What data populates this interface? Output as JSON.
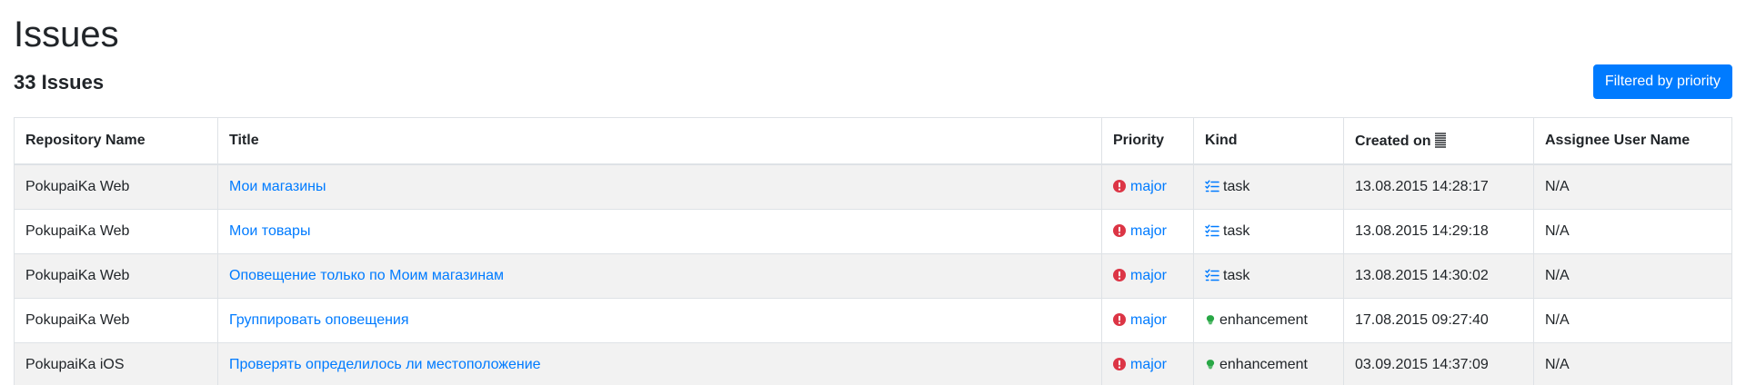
{
  "page": {
    "title": "Issues",
    "count_label": "33 Issues",
    "filter_button": "Filtered by priority"
  },
  "table": {
    "headers": {
      "repo": "Repository Name",
      "title": "Title",
      "priority": "Priority",
      "kind": "Kind",
      "created": "Created on",
      "assignee": "Assignee User Name"
    },
    "sort_icon": "sort-lines-icon",
    "rows": [
      {
        "repo": "PokupaiKa Web",
        "title": "Мои магазины",
        "priority": "major",
        "priority_icon": "exclamation-circle-icon",
        "kind": "task",
        "kind_icon": "task-list-icon",
        "created": "13.08.2015 14:28:17",
        "assignee": "N/A"
      },
      {
        "repo": "PokupaiKa Web",
        "title": "Мои товары",
        "priority": "major",
        "priority_icon": "exclamation-circle-icon",
        "kind": "task",
        "kind_icon": "task-list-icon",
        "created": "13.08.2015 14:29:18",
        "assignee": "N/A"
      },
      {
        "repo": "PokupaiKa Web",
        "title": "Оповещение только по Моим магазинам",
        "priority": "major",
        "priority_icon": "exclamation-circle-icon",
        "kind": "task",
        "kind_icon": "task-list-icon",
        "created": "13.08.2015 14:30:02",
        "assignee": "N/A"
      },
      {
        "repo": "PokupaiKa Web",
        "title": "Группировать оповещения",
        "priority": "major",
        "priority_icon": "exclamation-circle-icon",
        "kind": "enhancement",
        "kind_icon": "lightbulb-icon",
        "created": "17.08.2015 09:27:40",
        "assignee": "N/A"
      },
      {
        "repo": "PokupaiKa iOS",
        "title": "Проверять определилось ли местоположение",
        "priority": "major",
        "priority_icon": "exclamation-circle-icon",
        "kind": "enhancement",
        "kind_icon": "lightbulb-icon",
        "created": "03.09.2015 14:37:09",
        "assignee": "N/A"
      }
    ]
  },
  "colors": {
    "accent": "#007bff",
    "priority_major": "#dc3545",
    "enhancement": "#28a745",
    "task": "#007bff",
    "stripe": "#f2f2f2",
    "border": "#dee2e6"
  }
}
